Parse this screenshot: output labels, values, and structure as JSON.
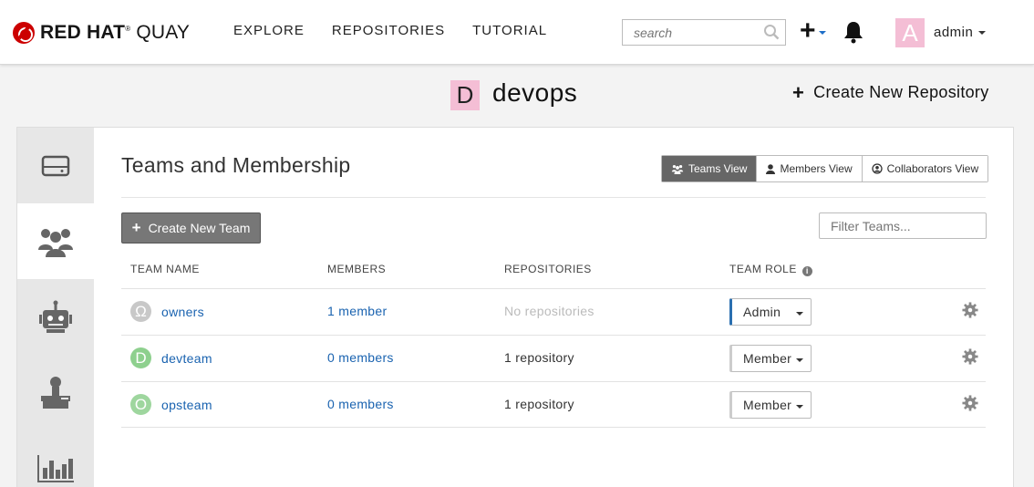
{
  "header": {
    "brand_bold": "RED HAT",
    "brand_reg": "®",
    "brand_light": " QUAY",
    "nav": [
      "EXPLORE",
      "REPOSITORIES",
      "TUTORIAL"
    ],
    "search_placeholder": "search",
    "user_avatar_letter": "A",
    "user_name": "admin"
  },
  "org": {
    "avatar_letter": "D",
    "name": "devops",
    "create_repo_label": "Create New Repository"
  },
  "sidebar": {
    "items": [
      "repositories-icon",
      "teams-icon",
      "robots-icon",
      "default-permissions-icon",
      "usage-logs-icon"
    ],
    "active_index": 1
  },
  "teams": {
    "title": "Teams and Membership",
    "views": [
      "Teams View",
      "Members View",
      "Collaborators View"
    ],
    "active_view": "Teams View",
    "create_team_label": "Create New Team",
    "filter_placeholder": "Filter Teams...",
    "columns": [
      "TEAM NAME",
      "MEMBERS",
      "REPOSITORIES",
      "TEAM ROLE"
    ],
    "rows": [
      {
        "avatar": "Ω",
        "avatar_color": "#c8c8c8",
        "name": "owners",
        "members": "1 member",
        "repos": "No repositories",
        "role": "Admin"
      },
      {
        "avatar": "D",
        "avatar_color": "#8ed08e",
        "name": "devteam",
        "members": "0 members",
        "repos": "1 repository",
        "role": "Member"
      },
      {
        "avatar": "O",
        "avatar_color": "#9ed69e",
        "name": "opsteam",
        "members": "0 members",
        "repos": "1 repository",
        "role": "Member"
      }
    ]
  }
}
